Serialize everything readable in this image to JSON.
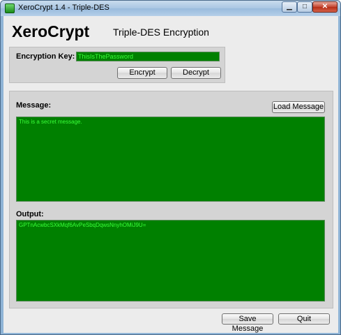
{
  "window": {
    "title": "XeroCrypt 1.4 - Triple-DES",
    "controls": {
      "minimize": "▁",
      "maximize": "□",
      "close": "✕"
    }
  },
  "header": {
    "app_name": "XeroCrypt",
    "subtitle": "Triple-DES Encryption"
  },
  "key_panel": {
    "label": "Encryption Key:",
    "key_value": "ThisIsThePassword",
    "encrypt_label": "Encrypt",
    "decrypt_label": "Decrypt"
  },
  "message": {
    "label": "Message:",
    "load_label": "Load Message",
    "text": "This is a secret message."
  },
  "output": {
    "label": "Output:",
    "text": "GPTnAcwbcSXkMqf6AvPeSbqDqwsNnyhOMiJ9U="
  },
  "footer": {
    "save_label": "Save Message",
    "quit_label": "Quit"
  },
  "colors": {
    "field_bg": "#008000",
    "field_text": "#39ff39",
    "panel_bg": "#d4d4d4"
  }
}
